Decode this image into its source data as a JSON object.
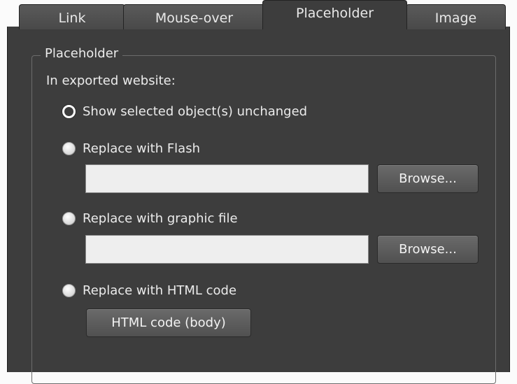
{
  "tabs": [
    {
      "label": "Link"
    },
    {
      "label": "Mouse-over"
    },
    {
      "label": "Placeholder"
    },
    {
      "label": "Image"
    }
  ],
  "active_tab": "Placeholder",
  "group": {
    "legend": "Placeholder",
    "subtitle": "In exported website:"
  },
  "options": [
    {
      "label": "Show selected object(s) unchanged",
      "selected": true
    },
    {
      "label": "Replace with Flash",
      "selected": false
    },
    {
      "label": "Replace with graphic file",
      "selected": false
    },
    {
      "label": "Replace with HTML code",
      "selected": false
    }
  ],
  "flash_field": {
    "value": ""
  },
  "graphic_field": {
    "value": ""
  },
  "buttons": {
    "browse_flash": "Browse...",
    "browse_graphic": "Browse...",
    "html_code": "HTML code (body)"
  }
}
